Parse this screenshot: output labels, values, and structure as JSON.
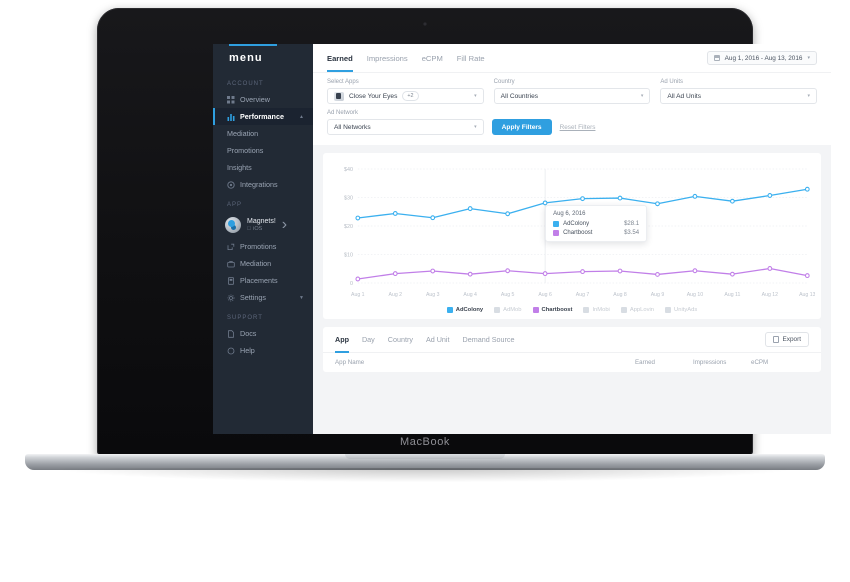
{
  "device": {
    "label": "MacBook"
  },
  "sidebar": {
    "brand": "menu",
    "sections": [
      {
        "label": "ACCOUNT",
        "items": [
          {
            "label": "Overview",
            "icon": "grid-icon",
            "active": false
          },
          {
            "label": "Performance",
            "icon": "bar-chart-icon",
            "active": true,
            "caret": "▲"
          }
        ],
        "subitems": [
          "Mediation",
          "Promotions",
          "Insights"
        ],
        "trailing": [
          {
            "label": "Integrations",
            "icon": "plug-icon"
          }
        ]
      },
      {
        "label": "APP",
        "app": {
          "name": "Magnets!",
          "platform": "iOS",
          "platform_icon": "apple-icon",
          "caret": "›"
        },
        "items": [
          {
            "label": "Promotions",
            "icon": "export-icon"
          },
          {
            "label": "Mediation",
            "icon": "briefcase-icon"
          },
          {
            "label": "Placements",
            "icon": "placement-icon"
          },
          {
            "label": "Settings",
            "icon": "gear-icon",
            "caret": "▼"
          }
        ]
      },
      {
        "label": "SUPPORT",
        "items": [
          {
            "label": "Docs",
            "icon": "doc-icon"
          },
          {
            "label": "Help",
            "icon": "help-icon"
          }
        ]
      }
    ]
  },
  "topbar": {
    "tabs": [
      {
        "label": "Earned",
        "active": true
      },
      {
        "label": "Impressions",
        "active": false
      },
      {
        "label": "eCPM",
        "active": false
      },
      {
        "label": "Fill Rate",
        "active": false
      }
    ],
    "date_range": "Aug 1, 2016  -  Aug 13, 2016",
    "date_icon": "calendar-icon",
    "caret": "▾"
  },
  "filters": {
    "select_apps": {
      "label": "Select Apps",
      "value": "Close Your Eyes",
      "badge": "+2"
    },
    "country": {
      "label": "Country",
      "value": "All Countries"
    },
    "ad_units": {
      "label": "Ad Units",
      "value": "All Ad Units"
    },
    "ad_network": {
      "label": "Ad Network",
      "value": "All Networks"
    },
    "apply_label": "Apply Filters",
    "reset_label": "Reset Filters",
    "caret": "▾"
  },
  "chart_data": {
    "type": "line",
    "title": "",
    "xlabel": "",
    "ylabel": "",
    "grid": true,
    "legend_position": "bottom",
    "ylim": [
      0,
      40
    ],
    "yticks": [
      0,
      10,
      20,
      30,
      40
    ],
    "ytick_labels": [
      "0",
      "$10",
      "$20",
      "$30",
      "$40"
    ],
    "categories": [
      "Aug 1",
      "Aug 2",
      "Aug 3",
      "Aug 4",
      "Aug 5",
      "Aug 6",
      "Aug 7",
      "Aug 8",
      "Aug 9",
      "Aug 10",
      "Aug 11",
      "Aug 12",
      "Aug 13"
    ],
    "series": [
      {
        "name": "AdColony",
        "color": "#3bb0ef",
        "active": true,
        "values": [
          22.8,
          24.4,
          22.9,
          26.1,
          24.3,
          28.1,
          29.6,
          29.8,
          27.8,
          30.4,
          28.7,
          30.7,
          32.9
        ]
      },
      {
        "name": "AdMob",
        "color": "#d8dde3",
        "active": false,
        "values": []
      },
      {
        "name": "Chartboost",
        "color": "#c17fe8",
        "active": true,
        "values": [
          1.4,
          3.3,
          4.2,
          3.1,
          4.3,
          3.3,
          4.0,
          4.2,
          3.0,
          4.3,
          3.1,
          5.1,
          2.6
        ]
      },
      {
        "name": "InMobi",
        "color": "#d8dde3",
        "active": false,
        "values": []
      },
      {
        "name": "AppLovin",
        "color": "#d8dde3",
        "active": false,
        "values": []
      },
      {
        "name": "UnityAds",
        "color": "#d8dde3",
        "active": false,
        "values": []
      }
    ],
    "tooltip": {
      "date": "Aug 6, 2016",
      "rows": [
        {
          "name": "AdColony",
          "value": "$28.1",
          "color": "#3bb0ef"
        },
        {
          "name": "Chartboost",
          "value": "$3.54",
          "color": "#c17fe8"
        }
      ]
    }
  },
  "table": {
    "tabs": [
      {
        "label": "App",
        "active": true
      },
      {
        "label": "Day",
        "active": false
      },
      {
        "label": "Country",
        "active": false
      },
      {
        "label": "Ad Unit",
        "active": false
      },
      {
        "label": "Demand Source",
        "active": false
      }
    ],
    "export_label": "Export",
    "export_icon": "export-icon",
    "columns": [
      "App Name",
      "Earned",
      "Impressions",
      "eCPM"
    ],
    "rows": []
  }
}
